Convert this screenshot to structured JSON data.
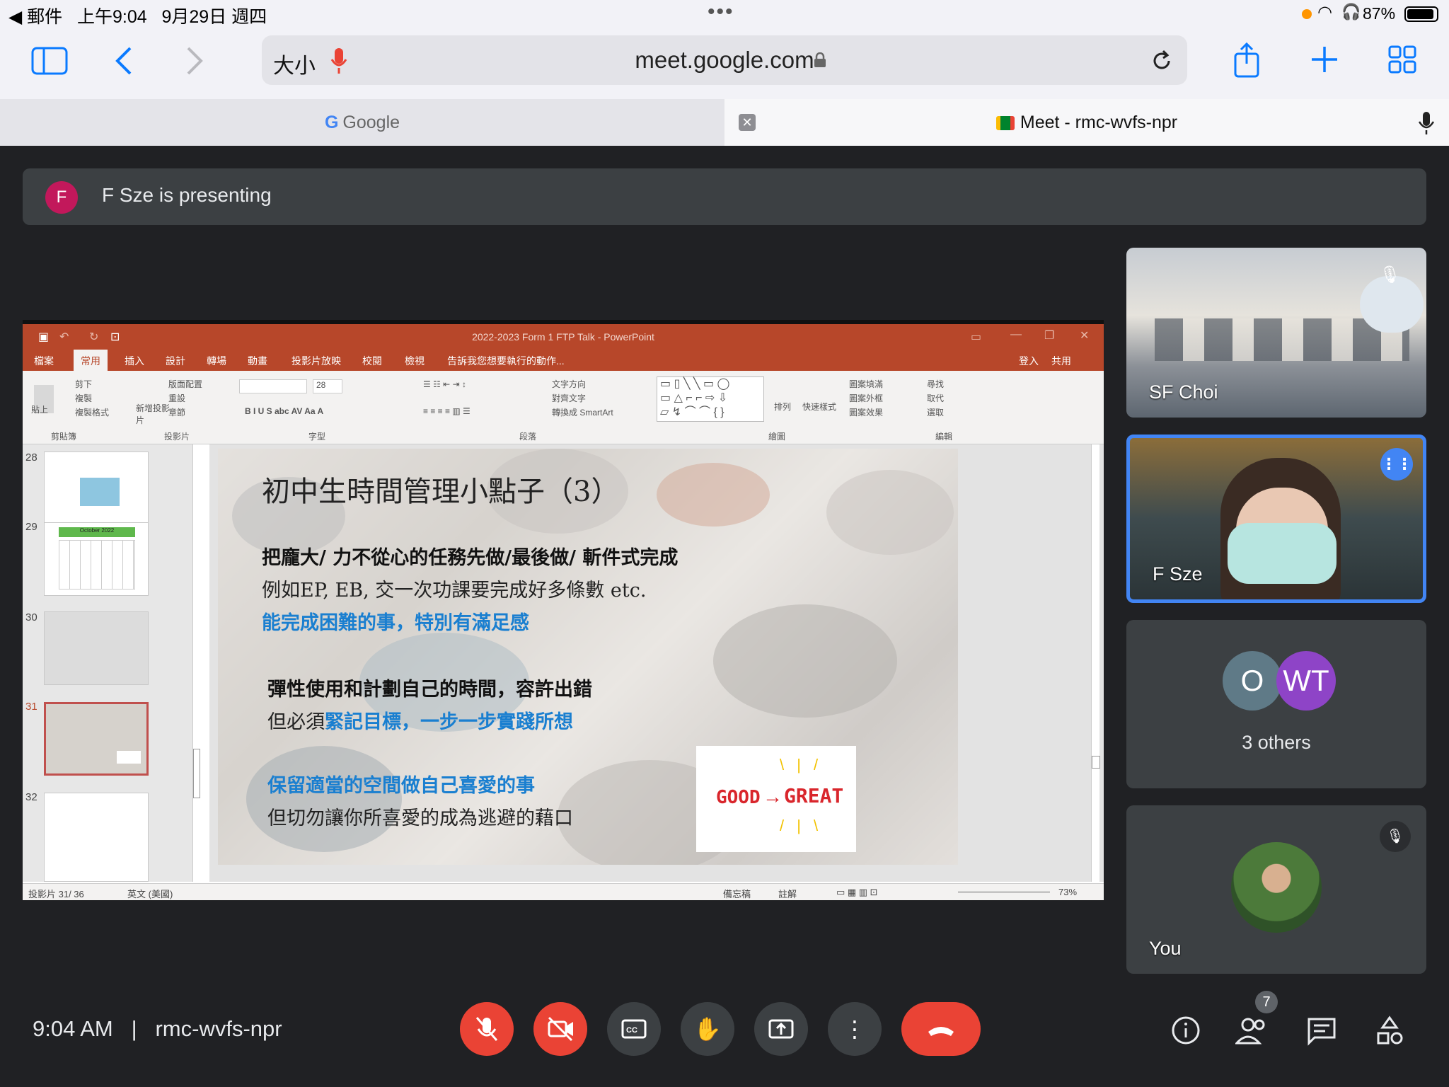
{
  "status_bar": {
    "left": "◀ 郵件   上午9:04   9月29日 週四",
    "dots": "•••",
    "battery": "87%"
  },
  "safari": {
    "text_size": "大小",
    "url": "meet.google.com",
    "tabs": [
      "Google",
      "Meet - rmc-wvfs-npr"
    ]
  },
  "meet": {
    "presenter_initial": "F",
    "banner": "F Sze is presenting",
    "time": "9:04 AM",
    "meeting_code": "rmc-wvfs-npr",
    "participant_count": "7",
    "tiles": [
      {
        "name": "SF Choi"
      },
      {
        "name": "F Sze"
      },
      {
        "name": "3 others",
        "avatars": [
          "O",
          "WT"
        ],
        "avatar_colors": [
          "#5f7a87",
          "#8e44c7"
        ]
      },
      {
        "name": "You"
      }
    ],
    "accent": "#ea4335",
    "active_border": "#4285f4"
  },
  "ppt": {
    "title": "2022-2023 Form 1 FTP Talk - PowerPoint",
    "menu": [
      "檔案",
      "常用",
      "插入",
      "設計",
      "轉場",
      "動畫",
      "投影片放映",
      "校閱",
      "檢視",
      "告訴我您想要執行的動作..."
    ],
    "login": "登入",
    "share": "共用",
    "ribbon": {
      "cut": "剪下",
      "copy": "複製",
      "format_painter": "複製格式",
      "paste": "貼上",
      "clipboard": "剪貼簿",
      "layout": "版面配置",
      "reset": "重設",
      "section": "章節",
      "new_slide": "新增投影片",
      "slides": "投影片",
      "font": "字型",
      "paragraph": "段落",
      "text_direction": "文字方向",
      "align_text": "對齊文字",
      "smartart": "轉換成 SmartArt",
      "drawing": "繪圖",
      "arrange": "排列",
      "quick_styles": "快速樣式",
      "shape_fill": "圖案填滿",
      "shape_outline": "圖案外框",
      "shape_effects": "圖案效果",
      "find": "尋找",
      "replace": "取代",
      "select": "選取",
      "editing": "編輯",
      "font_size": "28"
    },
    "thumb_numbers": [
      "28",
      "29",
      "30",
      "31",
      "32"
    ],
    "thumb_29_title": "October 2022",
    "slide": {
      "title": "初中生時間管理小點子（3）",
      "line1": "把龐大/ 力不從心的任務先做/最後做/ 斬件式完成",
      "line2": "例如EP, EB, 交一次功課要完成好多條數 etc.",
      "line3": "能完成困難的事，特別有滿足感",
      "line4": "彈性使用和計劃自己的時間，容許出錯",
      "line5a": "但必須",
      "line5b": "緊記目標，一步一步實踐所想",
      "line6": "保留適當的空間做自己喜愛的事",
      "line7": "但切勿讓你所喜愛的成為逃避的藉口",
      "good": "GOOD",
      "great": "GREAT",
      "blue": "#1a7fd0"
    },
    "status": {
      "slide_info": "投影片 31/ 36",
      "language": "英文 (美國)",
      "notes": "備忘稿",
      "comments": "註解",
      "zoom": "73%"
    }
  }
}
